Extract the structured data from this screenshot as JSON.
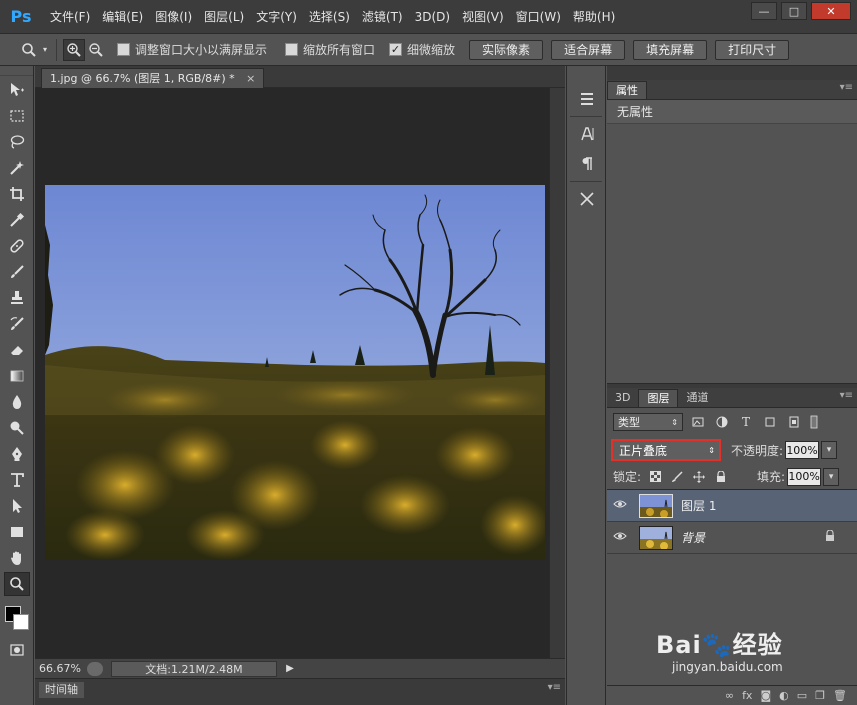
{
  "app": {
    "logo": "Ps"
  },
  "menu": [
    "文件(F)",
    "编辑(E)",
    "图像(I)",
    "图层(L)",
    "文字(Y)",
    "选择(S)",
    "滤镜(T)",
    "3D(D)",
    "视图(V)",
    "窗口(W)",
    "帮助(H)"
  ],
  "window": {
    "minimize": "—",
    "maximize": "□",
    "close": "✕"
  },
  "options": {
    "resize_windows": "调整窗口大小以满屏显示",
    "zoom_all_windows": "缩放所有窗口",
    "scrubby_zoom": "细微缩放",
    "actual_pixels": "实际像素",
    "fit_screen": "适合屏幕",
    "fill_screen": "填充屏幕",
    "print_size": "打印尺寸"
  },
  "document": {
    "tab_title": "1.jpg @ 66.7% (图层 1, RGB/8#) *",
    "tab_close": "×",
    "zoom": "66.67%",
    "doc_info": "文档:1.21M/2.48M",
    "arrow": "▶"
  },
  "timeline": {
    "label": "时间轴",
    "menu": "▾≡"
  },
  "properties": {
    "tab": "属性",
    "menu": "▾≡",
    "empty": "无属性"
  },
  "layers": {
    "tabs": [
      "3D",
      "图层",
      "通道"
    ],
    "menu": "▾≡",
    "filter_kind": "类型",
    "blend_mode": "正片叠底",
    "opacity_label": "不透明度:",
    "opacity_value": "100%",
    "lock_label": "锁定:",
    "fill_label": "填充:",
    "fill_value": "100%",
    "items": [
      {
        "name": "图层 1",
        "selected": true,
        "locked": false
      },
      {
        "name": "背景",
        "selected": false,
        "locked": true
      }
    ]
  },
  "watermark": {
    "main": "Bai🐾经验",
    "sub": "jingyan.baidu.com"
  }
}
